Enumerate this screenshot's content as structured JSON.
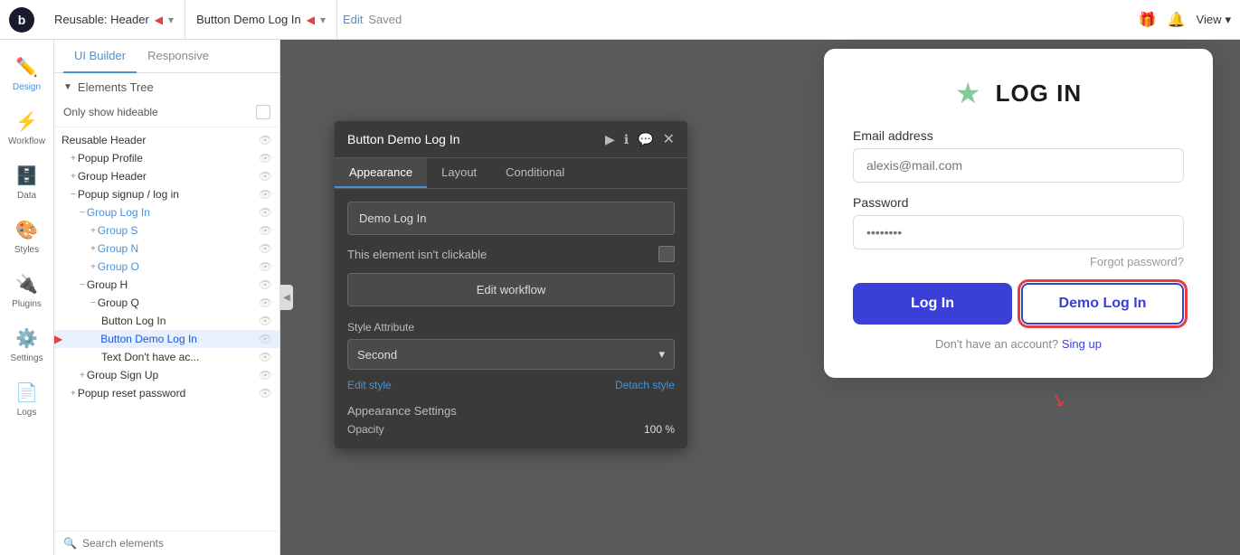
{
  "topbar": {
    "logo": "b",
    "section1_label": "Reusable: Header",
    "section1_arrow": "◀",
    "section1_chevron": "▾",
    "section2_label": "Button Demo Log In",
    "section2_arrow": "◀",
    "section2_chevron": "▾",
    "edit_label": "Edit",
    "saved_label": "Saved",
    "view_label": "View",
    "view_chevron": "▾"
  },
  "left_sidebar": {
    "items": [
      {
        "id": "design",
        "icon": "⬡",
        "label": "Design",
        "active": true
      },
      {
        "id": "workflow",
        "icon": "⬡",
        "label": "Workflow",
        "active": false
      },
      {
        "id": "data",
        "icon": "⬡",
        "label": "Data",
        "active": false
      },
      {
        "id": "styles",
        "icon": "⬡",
        "label": "Styles",
        "active": false
      },
      {
        "id": "plugins",
        "icon": "⬡",
        "label": "Plugins",
        "active": false
      },
      {
        "id": "settings",
        "icon": "⬡",
        "label": "Settings",
        "active": false
      },
      {
        "id": "logs",
        "icon": "⬡",
        "label": "Logs",
        "active": false
      }
    ]
  },
  "left_panel": {
    "tab1": "UI Builder",
    "tab2": "Responsive",
    "elements_tree_label": "Elements Tree",
    "only_show_label": "Only show hideable",
    "tree_items": [
      {
        "indent": 0,
        "prefix": "",
        "label": "Reusable Header",
        "blue": false
      },
      {
        "indent": 1,
        "prefix": "+",
        "label": "Popup Profile",
        "blue": false
      },
      {
        "indent": 1,
        "prefix": "+",
        "label": "Group Header",
        "blue": false
      },
      {
        "indent": 1,
        "prefix": "−",
        "label": "Popup signup / log in",
        "blue": false
      },
      {
        "indent": 2,
        "prefix": "−",
        "label": "Group Log In",
        "blue": true
      },
      {
        "indent": 3,
        "prefix": "+",
        "label": "Group S",
        "blue": true
      },
      {
        "indent": 3,
        "prefix": "+",
        "label": "Group N",
        "blue": true
      },
      {
        "indent": 3,
        "prefix": "+",
        "label": "Group O",
        "blue": true
      },
      {
        "indent": 2,
        "prefix": "−",
        "label": "Group H",
        "blue": false
      },
      {
        "indent": 3,
        "prefix": "−",
        "label": "Group Q",
        "blue": false
      },
      {
        "indent": 4,
        "prefix": "",
        "label": "Button Log In",
        "blue": false
      },
      {
        "indent": 4,
        "prefix": "",
        "label": "Button Demo Log In",
        "blue": true,
        "selected": true,
        "red_arrow": true
      },
      {
        "indent": 4,
        "prefix": "",
        "label": "Text Don't have ac...",
        "blue": false
      },
      {
        "indent": 2,
        "prefix": "+",
        "label": "Group Sign Up",
        "blue": false
      },
      {
        "indent": 1,
        "prefix": "+",
        "label": "Popup reset password",
        "blue": false
      }
    ],
    "search_placeholder": "Search elements"
  },
  "button_panel": {
    "title": "Button Demo Log In",
    "tabs": [
      "Appearance",
      "Layout",
      "Conditional"
    ],
    "active_tab": "Appearance",
    "demo_login_label": "Demo Log In",
    "not_clickable_label": "This element isn't clickable",
    "edit_workflow_label": "Edit workflow",
    "style_attr_label": "Style Attribute",
    "style_attr_value": "Second",
    "edit_style_label": "Edit style",
    "detach_style_label": "Detach style",
    "appearance_settings_label": "Appearance Settings",
    "opacity_label": "Opacity",
    "opacity_value": "100 %"
  },
  "login_card": {
    "title": "LOG IN",
    "email_label": "Email address",
    "email_placeholder": "alexis@mail.com",
    "password_label": "Password",
    "password_placeholder": "••••••••",
    "forgot_label": "Forgot password?",
    "login_btn_label": "Log In",
    "demo_btn_label": "Demo Log In",
    "signup_text": "Don't have an account?",
    "signup_link": "Sing up"
  }
}
